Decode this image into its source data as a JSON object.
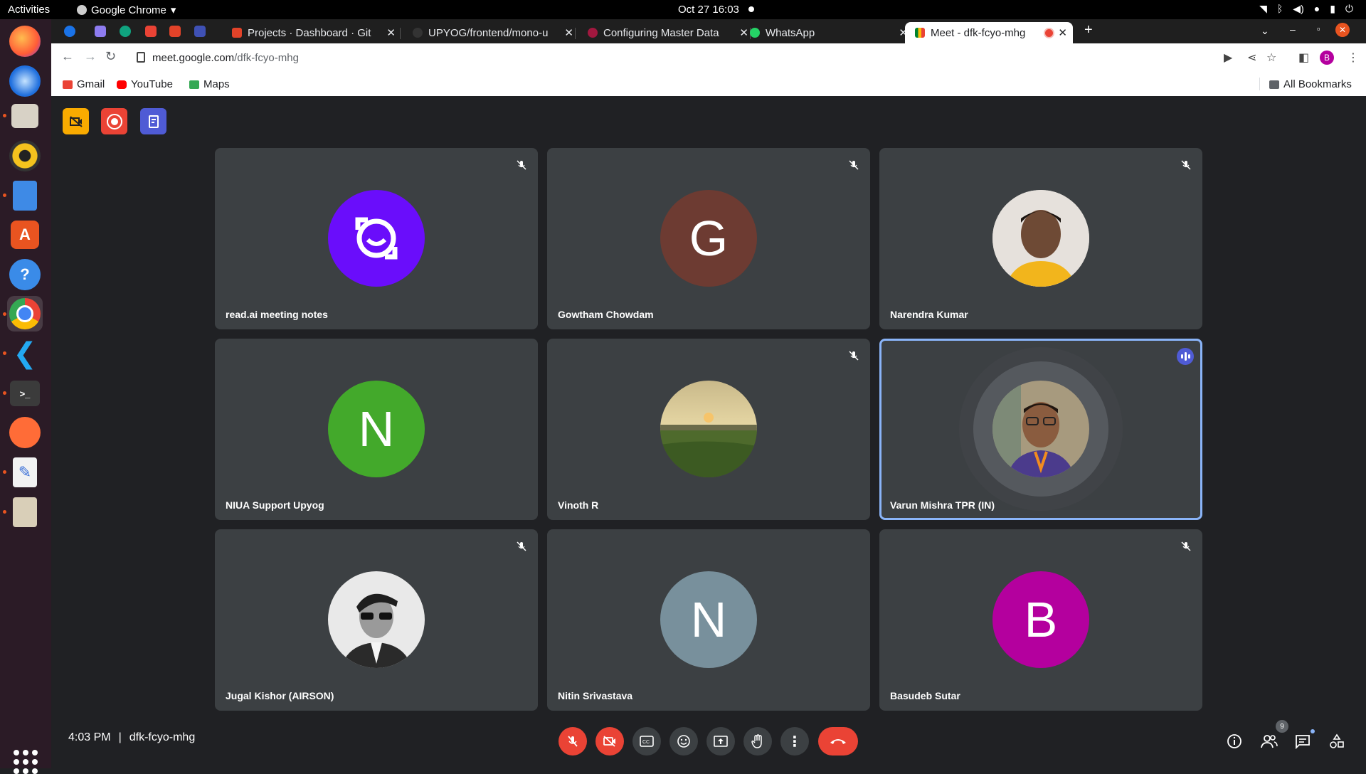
{
  "system": {
    "activities": "Activities",
    "app_menu": "Google Chrome",
    "clock": "Oct 27  16:03"
  },
  "tabs": [
    {
      "title": "Projects · Dashboard · Git",
      "favicon_color": "#e24329"
    },
    {
      "title": "UPYOG/frontend/mono-u",
      "favicon_color": "#333333"
    },
    {
      "title": "Configuring Master Data",
      "favicon_color": "#a1183f"
    },
    {
      "title": "WhatsApp",
      "favicon_color": "#25d366"
    },
    {
      "title": "Meet - dfk-fcyo-mhg",
      "favicon_color": "#00897b",
      "active": true
    }
  ],
  "address": {
    "host": "meet.google.com",
    "path": "/dfk-fcyo-mhg"
  },
  "profile_initial": "B",
  "bookmarks": [
    {
      "label": "Gmail",
      "color": "#ea4335"
    },
    {
      "label": "YouTube",
      "color": "#ff0000"
    },
    {
      "label": "Maps",
      "color": "#34a853"
    }
  ],
  "all_bookmarks": "All Bookmarks",
  "participants": [
    {
      "name": "read.ai meeting notes",
      "initial": "",
      "avatar_color": "#6a0dfb",
      "muted": true
    },
    {
      "name": "Gowtham Chowdam",
      "initial": "G",
      "avatar_color": "#6d3b32",
      "muted": true
    },
    {
      "name": "Narendra Kumar",
      "initial": "",
      "avatar_color": "#d9c6b4",
      "muted": true
    },
    {
      "name": "NIUA Support Upyog",
      "initial": "N",
      "avatar_color": "#43a92b",
      "muted": false
    },
    {
      "name": "Vinoth R",
      "initial": "",
      "avatar_color": "#7d7a3b",
      "muted": true
    },
    {
      "name": "Varun Mishra TPR (IN)",
      "initial": "",
      "avatar_color": "#8a6a55",
      "muted": false,
      "speaking": true
    },
    {
      "name": "Jugal Kishor (AIRSON)",
      "initial": "",
      "avatar_color": "#bdbdbd",
      "muted": true
    },
    {
      "name": "Nitin Srivastava",
      "initial": "N",
      "avatar_color": "#78909c",
      "muted": false
    },
    {
      "name": "Basudeb Sutar",
      "initial": "B",
      "avatar_color": "#b4009e",
      "muted": true
    }
  ],
  "meeting": {
    "time": "4:03 PM",
    "separator": "|",
    "code": "dfk-fcyo-mhg",
    "people_count": "9"
  }
}
